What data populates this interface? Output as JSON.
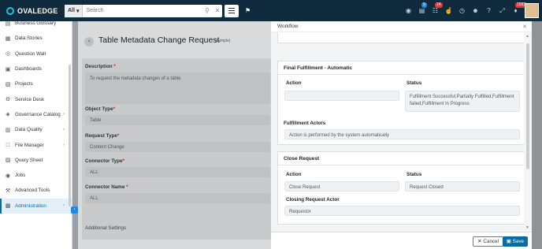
{
  "topbar": {
    "logo_text": "OVALEDGE",
    "search_scope": "All",
    "search_placeholder": "Search",
    "badges": {
      "notifications_a": "9",
      "cart": "14",
      "alerts": "1593"
    }
  },
  "sidebar": {
    "items": [
      {
        "label": "Business Glossary",
        "icon": "book-icon",
        "chevron": false
      },
      {
        "label": "Data Stories",
        "icon": "story-icon",
        "chevron": false
      },
      {
        "label": "Question Wall",
        "icon": "question-icon",
        "chevron": false
      },
      {
        "label": "Dashboards",
        "icon": "dashboard-icon",
        "chevron": false
      },
      {
        "label": "Projects",
        "icon": "projects-icon",
        "chevron": false
      },
      {
        "label": "Service Desk",
        "icon": "service-desk-icon",
        "chevron": false
      },
      {
        "label": "Governance Catalog",
        "icon": "governance-icon",
        "chevron": true
      },
      {
        "label": "Data Quality",
        "icon": "data-quality-icon",
        "chevron": true
      },
      {
        "label": "File Manager",
        "icon": "file-manager-icon",
        "chevron": true
      },
      {
        "label": "Query Sheet",
        "icon": "query-sheet-icon",
        "chevron": false
      },
      {
        "label": "Jobs",
        "icon": "jobs-icon",
        "chevron": false
      },
      {
        "label": "Advanced Tools",
        "icon": "tools-icon",
        "chevron": false
      },
      {
        "label": "Administration",
        "icon": "admin-icon",
        "chevron": true,
        "active": true
      }
    ]
  },
  "background_page": {
    "title": "Table Metadata Change Request",
    "subtitle": "(sample)",
    "description_label": "Description",
    "description_value": "To request the metadata changes of a table",
    "object_type_label": "Object Type",
    "object_type_value": "Table",
    "request_type_label": "Request Type",
    "request_type_value": "Content Change",
    "connector_type_label": "Connector Type",
    "connector_type_value": "ALL",
    "connector_name_label": "Connector Name",
    "connector_name_value": "ALL",
    "additional_settings": "Additional Settings"
  },
  "panel": {
    "title": "Workflow",
    "final_fulfillment": {
      "title": "Final Fulfillment - Automatic",
      "action_label": "Action",
      "action_value": "",
      "status_label": "Status",
      "status_value": "Fulfillment Successful,Partially Fulfilled,Fulfillment failed,Fulfillment In Progress",
      "actors_label": "Fulfillment Actors",
      "actors_value": "Action is performed by the system automatically"
    },
    "close_request": {
      "title": "Close Request",
      "action_label": "Action",
      "action_value": "Close Request",
      "status_label": "Status",
      "status_value": "Request Closed",
      "actor_label": "Closing Request Actor",
      "actor_value": "Requestor"
    },
    "cancel_label": "Cancel",
    "save_label": "Save"
  },
  "colors": {
    "topbar": "#0f2b3d",
    "accent": "#0b6aa2",
    "badge_red": "#e53935",
    "badge_blue": "#1e88e5"
  }
}
